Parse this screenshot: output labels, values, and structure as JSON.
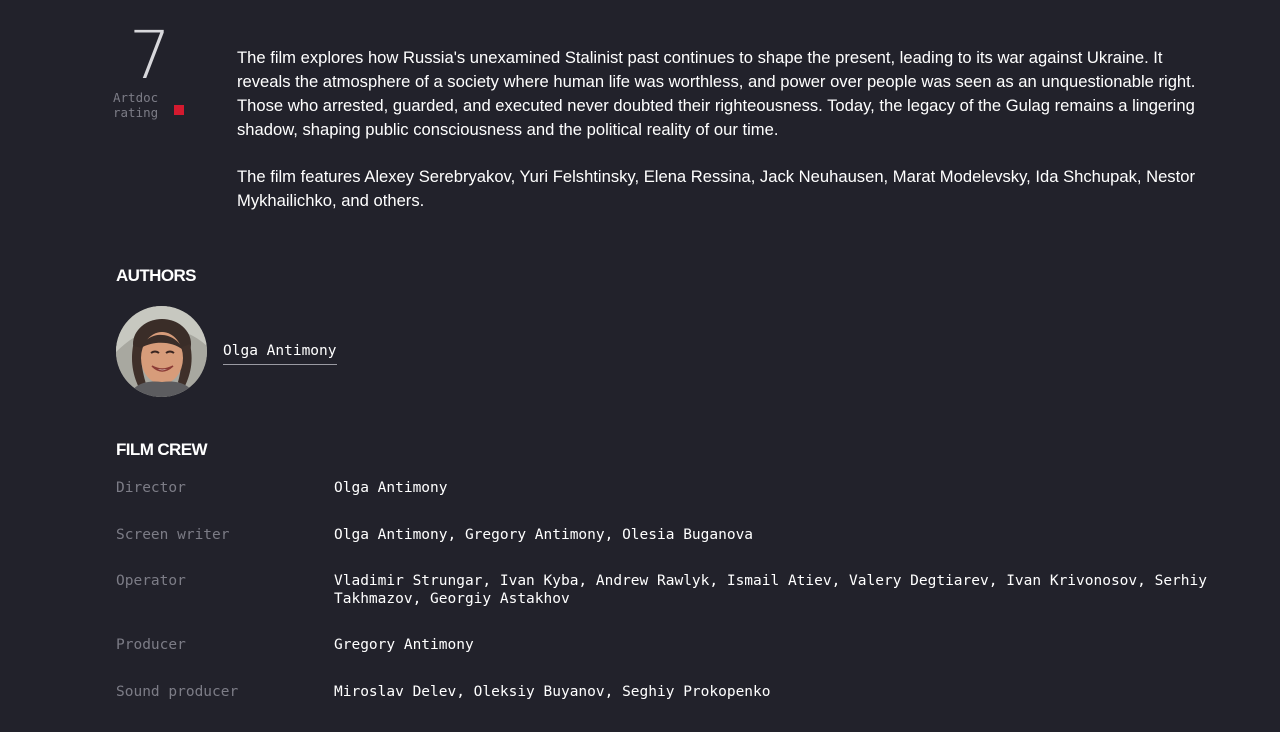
{
  "rating": {
    "value": "7",
    "label": "Artdoc\nrating",
    "marker_color": "#d41a2f"
  },
  "description": {
    "paragraphs": [
      "The film explores how Russia's unexamined Stalinist past continues to shape the present, leading to its war against Ukraine. It reveals the atmosphere of a society where human life was worthless, and power over people was seen as an unquestionable right. Those who arrested, guarded, and executed never doubted their righteousness. Today, the legacy of the Gulag remains a lingering shadow, shaping public consciousness and the political reality of our time.",
      "The film features Alexey Serebryakov, Yuri Felshtinsky, Elena Ressina, Jack Neuhausen, Marat Modelevsky, Ida Shchupak, Nestor Mykhailichko, and others."
    ]
  },
  "authors": {
    "title": "AUTHORS",
    "items": [
      {
        "name": "Olga Antimony",
        "avatar_icon": "author-portrait"
      }
    ]
  },
  "crew": {
    "title": "FILM CREW",
    "rows": [
      {
        "role": "Director",
        "names": "Olga Antimony"
      },
      {
        "role": "Screen writer",
        "names": "Olga Antimony, Gregory Antimony, Olesia Buganova"
      },
      {
        "role": "Operator",
        "names": "Vladimir Strungar, Ivan Kyba, Andrew Rawlyk, Ismail Atiev, Valery Degtiarev, Ivan Krivonosov, Serhiy Takhmazov, Georgiy Astakhov"
      },
      {
        "role": "Producer",
        "names": "Gregory Antimony"
      },
      {
        "role": "Sound producer",
        "names": "Miroslav Delev, Oleksiy Buyanov, Seghiy Prokopenko"
      }
    ]
  },
  "colors": {
    "background": "#22222b",
    "text": "#ffffff",
    "muted": "#7c7c86",
    "accent": "#d41a2f"
  }
}
